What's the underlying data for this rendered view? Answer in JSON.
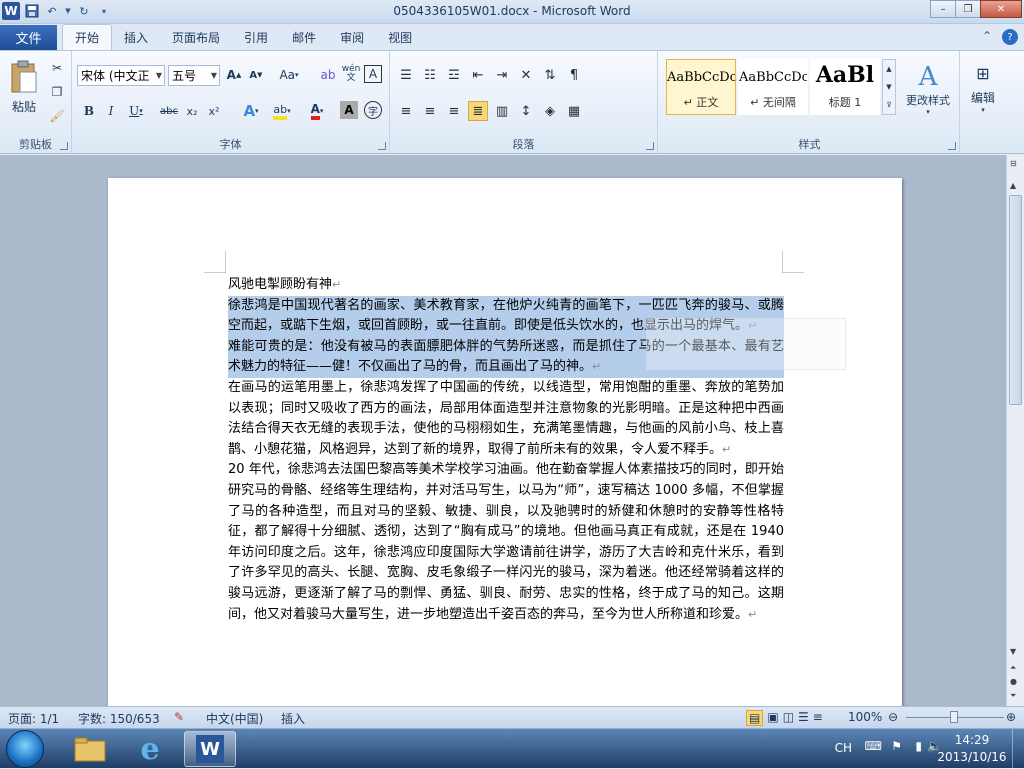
{
  "window": {
    "title": "0504336105W01.docx - Microsoft Word"
  },
  "ribbon_tabs": {
    "file": "文件",
    "tabs": [
      "开始",
      "插入",
      "页面布局",
      "引用",
      "邮件",
      "审阅",
      "视图"
    ]
  },
  "clipboard": {
    "paste": "粘贴",
    "label": "剪贴板"
  },
  "font": {
    "name": "宋体 (中文正",
    "size": "五号",
    "label": "字体",
    "grow": "A",
    "shrink": "A",
    "case": "Aa",
    "bold": "B",
    "italic": "I",
    "underline": "U",
    "strike": "abc",
    "sub": "x₂",
    "sup": "x²",
    "wen": "wén",
    "border_a": "A",
    "char_shade": "A",
    "enclose": "字"
  },
  "paragraph": {
    "label": "段落"
  },
  "styles": {
    "label": "样式",
    "items": [
      {
        "preview": "AaBbCcDc",
        "name": "↵ 正文"
      },
      {
        "preview": "AaBbCcDc",
        "name": "↵ 无间隔"
      },
      {
        "preview": "AaBl",
        "name": "标题 1"
      }
    ],
    "change": "更改样式",
    "change_icon": "A"
  },
  "editing": {
    "label": "编辑"
  },
  "document": {
    "heading": "风驰电掣顾盼有神",
    "p1": "徐悲鸿是中国现代著名的画家、美术教育家，在他炉火纯青的画笔下，一匹匹飞奔的骏马、或腾空而起，或踮下生烟，或回首顾盼，或一往直前。即使是低头饮水的，也显示出马的焊气。",
    "p2": "难能可贵的是：他没有被马的表面膘肥体胖的气势所迷惑，而是抓住了马的一个最基本、最有艺术魅力的特征——健！不仅画出了马的骨，而且画出了马的神。",
    "p3": "在画马的运笔用墨上，徐悲鸿发挥了中国画的传统，以线造型，常用饱酣的重墨、奔放的笔势加以表现；同时又吸收了西方的画法，局部用体面造型并注意物象的光影明暗。正是这种把中西画法结合得天衣无缝的表现手法，使他的马栩栩如生，充满笔墨情趣，与他画的风前小鸟、枝上喜鹊、小憩花猫，风格迥异，达到了新的境界，取得了前所未有的效果，令人爱不释手。",
    "p4": "20 年代，徐悲鸿去法国巴黎高等美术学校学习油画。他在勤奋掌握人体素描技巧的同时，即开始研究马的骨骼、经络等生理结构，并对活马写生，以马为“师”，速写稿达 1000 多幅，不但掌握了马的各种造型，而且对马的坚毅、敏捷、驯良，以及驰骋时的矫健和休憩时的安静等性格特征，都了解得十分细腻、透彻，达到了“胸有成马”的境地。但他画马真正有成就，还是在 1940 年访问印度之后。这年，徐悲鸿应印度国际大学邀请前往讲学，游历了大吉岭和克什米乐，看到了许多罕见的高头、长腿、宽胸、皮毛象缎子一样闪光的骏马，深为着迷。他还经常骑着这样的骏马远游，更逐渐了解了马的剽悍、勇猛、驯良、耐劳、忠实的性格，终于成了马的知己。这期间，他又对着骏马大量写生，进一步地塑造出千姿百态的奔马，至今为世人所称道和珍爱。"
  },
  "status": {
    "page": "页面: 1/1",
    "words": "字数: 150/653",
    "lang": "中文(中国)",
    "mode": "插入",
    "zoom": "100%"
  },
  "tray": {
    "lang": "CH",
    "time": "14:29",
    "date": "2013/10/16"
  }
}
